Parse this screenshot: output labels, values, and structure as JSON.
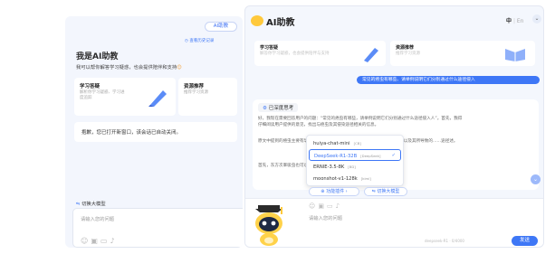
{
  "left": {
    "ai_button": "AI助教",
    "history_link": "查看历史记录",
    "title": "我是AI助教",
    "intro": "我可以帮你解答学习疑惑，也会提供陪伴和支持",
    "cards": [
      {
        "title": "学习答疑",
        "sub": "解析你学习疑惑、学习进度追踪"
      },
      {
        "title": "资源推荐",
        "sub": "推荐学习资源"
      }
    ],
    "notice": "抱歉，您已打开新窗口，该会话已自动关闭。",
    "switch_model": "切换大模型",
    "input_placeholder": "请输入您的问题"
  },
  "right": {
    "title": "AI助教",
    "lang_zh": "中",
    "lang_en": "En",
    "cards": [
      {
        "title": "学习答疑",
        "sub": "解答你学习疑惑，也会提供陪伴与支持"
      },
      {
        "title": "资源推荐",
        "sub": "推荐学习资源"
      }
    ],
    "question": "常见的癌虫有哪些、请举例说明它们分别通过什么途径侵入",
    "thinking_label": "已深度思考",
    "answer_p1": "好，我现在需要回答用户的问题：“常见的癌虫有哪些，请举例说明它们分别通过什么途径侵入人”。首先，我得仔细阅读用户提供的意见，找出与癌虫及其侵染途径相关的信息。",
    "answer_p2": "原文中提到的癌虫主要有华支睾吸虫、东方次睾吸虫和猫后睾吸虫。华支睾吸虫以及其所导致的……途径述。",
    "answer_p3": "首先，东方次睾吸虫也可以通过……台湾次睾吸虫和属体次睾……",
    "models": [
      {
        "name": "huiya-chat-mini",
        "tag": "[CB]",
        "selected": false
      },
      {
        "name": "DeepSeek-R1-32B",
        "tag": "[DeepSeek]",
        "selected": true
      },
      {
        "name": "ERNIE-3.5-8K",
        "tag": "[BD]",
        "selected": false
      },
      {
        "name": "moonshot-v1-128k",
        "tag": "[kimi]",
        "selected": false
      }
    ],
    "check": "✓",
    "plugin_chip": "功能插件",
    "switch_model": "切换大模型",
    "input_placeholder": "请输入您的问题",
    "counter": "deepseek-R1 · 0/4000",
    "send": "发送"
  },
  "colors": {
    "accent": "#3e77f6",
    "bg": "#f4f7fd"
  }
}
